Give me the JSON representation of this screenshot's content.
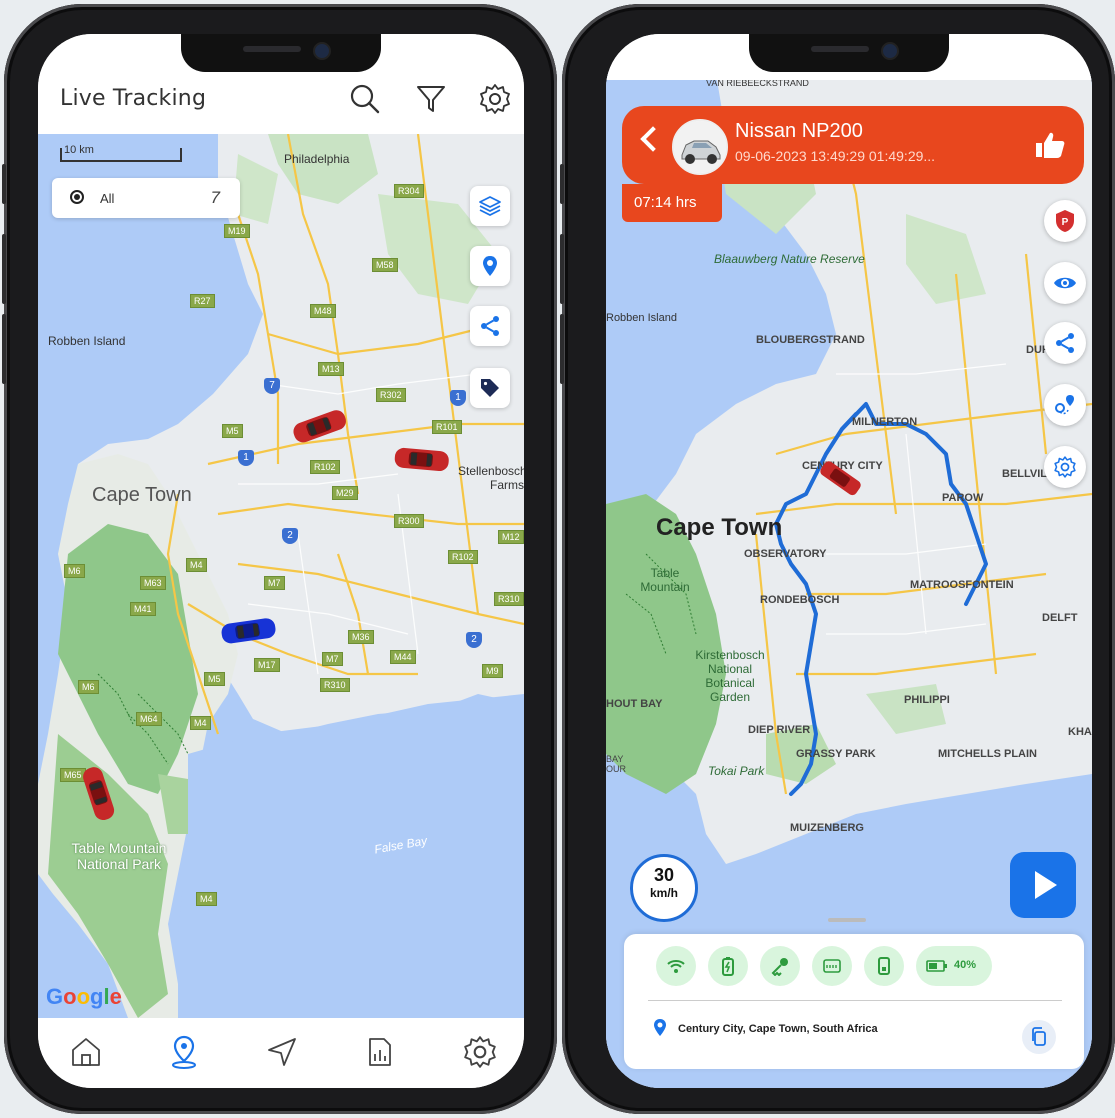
{
  "left_screen": {
    "header": {
      "title": "Live Tracking"
    },
    "scale": "10 km",
    "filter": {
      "label": "All",
      "count": "7"
    },
    "map_labels": {
      "philadelphia": "Philadelphia",
      "robben_island": "Robben Island",
      "cape_town": "Cape Town",
      "stellenbosch": "Stellenbosch Farms",
      "table_mountain": "Table Mountain National Park",
      "false_bay": "False Bay",
      "google": "Google"
    },
    "road_shields": [
      "R304",
      "M19",
      "M58",
      "R27",
      "M48",
      "M13",
      "R302",
      "R101",
      "M5",
      "R102",
      "M29",
      "R300",
      "M4",
      "R102",
      "M12",
      "M6",
      "M63",
      "M41",
      "M7",
      "R310",
      "M36",
      "M44",
      "M17",
      "M7",
      "M5",
      "M9",
      "R310",
      "M6",
      "M64",
      "M4",
      "M65",
      "M4"
    ],
    "icons": [
      "search-icon",
      "filter-icon",
      "settings-icon",
      "layers-icon",
      "location-pin-icon",
      "share-icon",
      "tag-icon",
      "home-icon",
      "map-pin-icon",
      "navigation-icon",
      "report-icon",
      "settings-icon"
    ]
  },
  "right_screen": {
    "vehicle": {
      "name": "Nissan NP200",
      "datetime": "09-06-2023 13:49:29 01:49:29..."
    },
    "timer": "07:14 hrs",
    "map_labels": {
      "van_riebeeckstrand": "VAN RIEBEECKSTRAND",
      "blaauwberg": "Blaauwberg Nature Reserve",
      "robben_island": "Robben Island",
      "bloubergstrand": "BLOUBERGSTRAND",
      "durbanville": "DURBANVI",
      "milnerton": "MILNERTON",
      "century_city": "CENTURY CITY",
      "bellville": "BELLVILLE",
      "parow": "PAROW",
      "cape_town": "Cape Town",
      "observatory": "OBSERVATORY",
      "table_mountain": "Table Mountain",
      "matroosfontein": "MATROOSFONTEIN",
      "rondebosch": "RONDEBOSCH",
      "delft": "DELFT",
      "kirstenbosch": "Kirstenbosch National Botanical Garden",
      "hout_bay": "HOUT BAY",
      "philippi": "PHILIPPI",
      "diep_river": "DIEP RIVER",
      "kha": "KHA",
      "grassy_park": "GRASSY PARK",
      "mitchells_plain": "MITCHELLS PLAIN",
      "bay": "BAY OUR",
      "tokai_park": "Tokai Park",
      "muizenberg": "MUIZENBERG"
    },
    "speed": {
      "value": "30",
      "unit": "km/h"
    },
    "battery": "40%",
    "address": "Century City, Cape Town, South Africa",
    "colors": {
      "accent": "#e8471e",
      "route": "#1f6cd6",
      "status_bg": "#d9f5dd"
    }
  }
}
